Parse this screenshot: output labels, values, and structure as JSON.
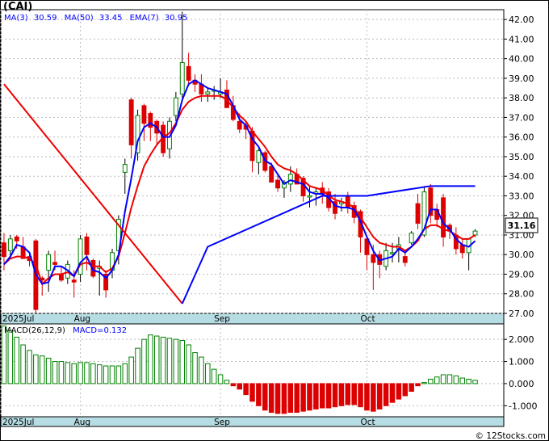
{
  "chart_data": [
    {
      "type": "candlestick",
      "title": "(CAI)",
      "legend": [
        "MA(3)",
        "30.59",
        "MA(50)",
        "33.45",
        "EMA(7)",
        "30.95"
      ],
      "colors": {
        "ma3": "#0000ff",
        "ma50": "#0000ff",
        "ema7": "#ee0000",
        "up": "#008000",
        "down": "#dd0000",
        "axis_band": "#b7dde4"
      },
      "y_ticks": [
        "42.00",
        "41.00",
        "40.00",
        "39.00",
        "38.00",
        "37.00",
        "36.00",
        "35.00",
        "34.00",
        "33.00",
        "32.00",
        "31.00",
        "30.00",
        "29.00",
        "28.00",
        "27.00"
      ],
      "ylim": [
        27,
        42.5
      ],
      "last_price": "31.16",
      "x_labels": [
        "2025Jul",
        "Aug",
        "Sep",
        "Oct"
      ],
      "x_label_index": [
        0,
        12,
        34,
        57
      ],
      "candles": [
        [
          30.6,
          31.1,
          29.2,
          29.9
        ],
        [
          30.2,
          31.0,
          29.8,
          30.8
        ],
        [
          30.9,
          31.0,
          30.3,
          30.7
        ],
        [
          30.4,
          30.9,
          29.8,
          29.8
        ],
        [
          29.9,
          30.0,
          29.4,
          29.7
        ],
        [
          30.7,
          30.8,
          27.0,
          27.2
        ],
        [
          28.8,
          28.9,
          27.9,
          28.7
        ],
        [
          29.2,
          30.2,
          28.1,
          30.0
        ],
        [
          29.6,
          30.2,
          29.2,
          29.5
        ],
        [
          29.0,
          29.4,
          28.6,
          28.7
        ],
        [
          28.8,
          29.7,
          28.5,
          29.5
        ],
        [
          28.7,
          29.2,
          27.8,
          28.6
        ],
        [
          29.0,
          31.0,
          28.6,
          30.8
        ],
        [
          30.9,
          31.1,
          29.2,
          30.0
        ],
        [
          29.7,
          29.8,
          28.8,
          28.9
        ],
        [
          29.3,
          29.7,
          27.9,
          29.4
        ],
        [
          29.0,
          29.2,
          27.8,
          28.2
        ],
        [
          29.2,
          30.3,
          28.8,
          30.1
        ],
        [
          30.2,
          32.0,
          29.5,
          31.8
        ],
        [
          34.2,
          34.9,
          33.1,
          34.6
        ],
        [
          37.9,
          38.0,
          34.9,
          35.6
        ],
        [
          35.2,
          37.4,
          34.8,
          37.1
        ],
        [
          37.6,
          37.7,
          35.8,
          36.7
        ],
        [
          37.2,
          37.3,
          35.8,
          36.5
        ],
        [
          36.8,
          36.9,
          35.6,
          36.2
        ],
        [
          36.6,
          36.8,
          35.0,
          35.2
        ],
        [
          35.4,
          37.0,
          34.9,
          36.8
        ],
        [
          37.1,
          38.3,
          36.8,
          38.0
        ],
        [
          38.2,
          42.4,
          38.0,
          39.8
        ],
        [
          39.6,
          40.3,
          38.6,
          38.9
        ],
        [
          38.9,
          39.2,
          38.3,
          38.7
        ],
        [
          38.7,
          39.2,
          37.8,
          38.2
        ],
        [
          38.2,
          38.5,
          37.8,
          38.3
        ],
        [
          38.4,
          38.6,
          37.9,
          38.4
        ],
        [
          38.2,
          39.0,
          38.0,
          38.3
        ],
        [
          38.4,
          38.9,
          37.6,
          37.5
        ],
        [
          37.6,
          38.1,
          36.8,
          36.9
        ],
        [
          36.8,
          37.2,
          36.2,
          36.4
        ],
        [
          36.6,
          36.8,
          35.9,
          36.4
        ],
        [
          36.3,
          36.5,
          34.2,
          34.8
        ],
        [
          34.7,
          35.4,
          34.1,
          35.3
        ],
        [
          35.2,
          35.3,
          34.2,
          34.3
        ],
        [
          34.5,
          34.7,
          33.8,
          33.7
        ],
        [
          33.8,
          34.1,
          33.2,
          33.4
        ],
        [
          33.4,
          33.8,
          32.9,
          33.7
        ],
        [
          33.6,
          34.5,
          33.2,
          34.1
        ],
        [
          34.1,
          34.4,
          33.6,
          33.6
        ],
        [
          33.9,
          34.0,
          32.7,
          33.0
        ],
        [
          33.0,
          33.5,
          32.4,
          33.0
        ],
        [
          33.1,
          33.4,
          32.5,
          33.2
        ],
        [
          33.4,
          33.7,
          32.6,
          33.1
        ],
        [
          33.2,
          33.4,
          32.2,
          32.4
        ],
        [
          32.7,
          33.1,
          31.8,
          32.1
        ],
        [
          32.6,
          32.9,
          32.2,
          32.7
        ],
        [
          33.0,
          33.2,
          32.1,
          32.4
        ],
        [
          32.5,
          32.7,
          31.6,
          31.9
        ],
        [
          32.2,
          32.3,
          30.1,
          30.9
        ],
        [
          30.8,
          30.9,
          29.2,
          30.0
        ],
        [
          30.0,
          30.5,
          28.2,
          29.6
        ],
        [
          30.0,
          30.2,
          28.8,
          29.5
        ],
        [
          29.4,
          30.6,
          29.2,
          30.2
        ],
        [
          30.1,
          30.6,
          29.6,
          30.1
        ],
        [
          30.3,
          30.9,
          29.6,
          30.5
        ],
        [
          29.9,
          30.2,
          29.4,
          29.6
        ],
        [
          30.6,
          31.2,
          30.5,
          31.1
        ],
        [
          32.6,
          33.1,
          31.3,
          31.6
        ],
        [
          31.0,
          33.5,
          30.9,
          33.2
        ],
        [
          33.4,
          33.6,
          31.6,
          32.0
        ],
        [
          32.3,
          32.6,
          31.4,
          31.8
        ],
        [
          32.9,
          33.1,
          30.4,
          30.9
        ],
        [
          31.5,
          31.6,
          30.8,
          31.2
        ],
        [
          31.0,
          31.4,
          30.0,
          30.3
        ],
        [
          30.5,
          30.8,
          29.8,
          30.1
        ],
        [
          30.1,
          30.8,
          29.2,
          30.8
        ],
        [
          31.0,
          31.3,
          30.9,
          31.2
        ]
      ],
      "ema7": [
        29.5,
        29.8,
        29.9,
        29.9,
        29.8,
        29.5,
        28.5,
        28.8,
        29.0,
        29.0,
        29.1,
        28.9,
        29.5,
        29.6,
        29.4,
        29.4,
        29.1,
        29.3,
        29.9,
        31.1,
        32.4,
        33.5,
        34.5,
        35.1,
        35.6,
        36.0,
        36.2,
        36.7,
        37.4,
        37.8,
        38.0,
        38.1,
        38.1,
        38.1,
        38.1,
        37.9,
        37.5,
        37.1,
        36.8,
        36.3,
        35.9,
        35.5,
        35.0,
        34.6,
        34.4,
        34.3,
        34.1,
        33.8,
        33.5,
        33.4,
        33.3,
        33.0,
        32.8,
        32.7,
        32.6,
        32.4,
        31.9,
        31.4,
        30.9,
        30.6,
        30.5,
        30.4,
        30.4,
        30.2,
        30.4,
        30.7,
        31.3,
        31.5,
        31.5,
        31.3,
        31.2,
        31.0,
        30.8,
        30.8,
        31.0
      ],
      "ma3": [
        29.5,
        29.9,
        30.5,
        30.4,
        30.1,
        29.0,
        28.5,
        28.6,
        29.4,
        29.4,
        29.2,
        28.9,
        29.6,
        29.9,
        29.2,
        29.1,
        28.8,
        29.2,
        30.0,
        32.2,
        33.9,
        35.8,
        36.5,
        36.7,
        36.5,
        36.0,
        36.0,
        36.6,
        37.9,
        38.7,
        38.9,
        38.7,
        38.5,
        38.4,
        38.3,
        38.2,
        37.6,
        36.9,
        36.6,
        35.9,
        35.5,
        34.8,
        34.6,
        34.1,
        33.6,
        33.8,
        33.7,
        33.6,
        33.2,
        33.1,
        33.1,
        32.9,
        32.5,
        32.4,
        32.4,
        32.3,
        31.7,
        30.9,
        30.2,
        29.7,
        29.8,
        29.9,
        30.3,
        30.1,
        30.4,
        30.8,
        31.3,
        32.3,
        32.3,
        31.6,
        31.3,
        30.8,
        30.5,
        30.4,
        30.7
      ],
      "ma50": [
        [
          0,
          38.7
        ],
        [
          28,
          27.5
        ],
        [
          32,
          30.4
        ],
        [
          50,
          33.0
        ],
        [
          57,
          33.0
        ],
        [
          67,
          33.5
        ],
        [
          74,
          33.5
        ]
      ],
      "n_slots": 75
    },
    {
      "type": "bar",
      "title": "MACD(26,12,9)",
      "legend": [
        "MACD(26,12,9)",
        "MACD=0.132"
      ],
      "y_ticks": [
        "2.000",
        "1.000",
        "0.000",
        "-1.000"
      ],
      "ylim": [
        -1.5,
        2.7
      ],
      "x_labels": [
        "2025Jul",
        "Aug",
        "Sep",
        "Oct"
      ],
      "values": [
        2.6,
        2.4,
        2.1,
        1.75,
        1.5,
        1.3,
        1.25,
        1.15,
        1.0,
        1.0,
        0.95,
        0.9,
        0.95,
        0.95,
        0.9,
        0.85,
        0.8,
        0.8,
        0.8,
        0.9,
        1.2,
        1.6,
        2.0,
        2.2,
        2.15,
        2.1,
        2.05,
        2.0,
        1.95,
        1.75,
        1.4,
        1.2,
        0.9,
        0.65,
        0.4,
        0.15,
        -0.1,
        -0.25,
        -0.5,
        -0.8,
        -1.0,
        -1.2,
        -1.3,
        -1.35,
        -1.35,
        -1.3,
        -1.3,
        -1.25,
        -1.2,
        -1.15,
        -1.1,
        -1.1,
        -1.05,
        -1.0,
        -0.95,
        -0.95,
        -1.05,
        -1.2,
        -1.25,
        -1.15,
        -1.0,
        -0.85,
        -0.7,
        -0.55,
        -0.35,
        -0.1,
        0.05,
        0.2,
        0.3,
        0.4,
        0.4,
        0.35,
        0.25,
        0.2,
        0.15
      ]
    }
  ],
  "footer": "© 12Stocks.com"
}
